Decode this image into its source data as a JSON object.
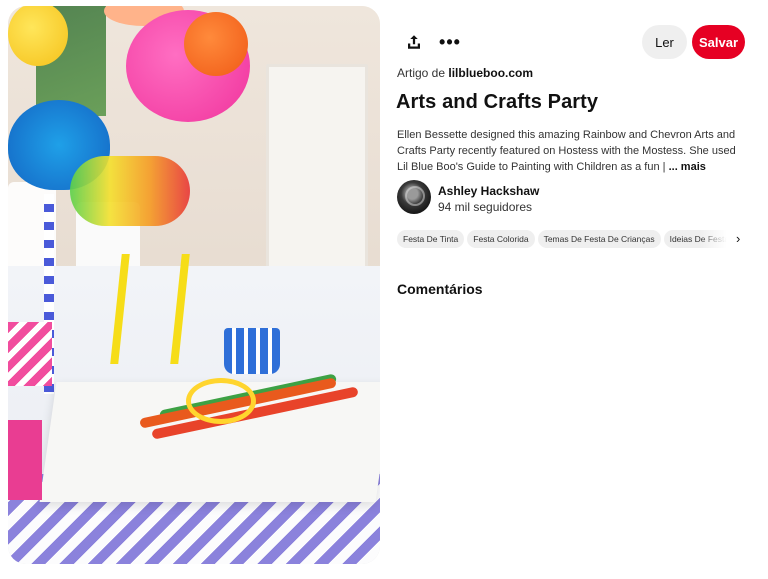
{
  "pin": {
    "image_alt": "Rainbow arts and crafts party table with paint brushes, easels and paper lanterns"
  },
  "toolbar": {
    "share_icon": "share-upload-icon",
    "more_icon": "more-dots-icon",
    "more_label": "•••",
    "read_label": "Ler",
    "save_label": "Salvar",
    "save_color": "#e60023"
  },
  "source": {
    "prefix": "Artigo de",
    "domain": "lilblueboo.com"
  },
  "title": "Arts and Crafts Party",
  "description": {
    "text": "Ellen Bessette designed this amazing Rainbow and Chevron Arts and Crafts Party recently featured on Hostess with the Mostess. She used Lil Blue Boo's Guide to Painting with Children as a fun |",
    "more": "... mais"
  },
  "author": {
    "name": "Ashley Hackshaw",
    "followers": "94 mil seguidores"
  },
  "tags": [
    "Festa De Tinta",
    "Festa Colorida",
    "Temas De Festa De Crianças",
    "Ideias De Festa De"
  ],
  "tags_arrow_icon": "chevron-right-icon",
  "tags_arrow": "›",
  "comments_heading": "Comentários"
}
